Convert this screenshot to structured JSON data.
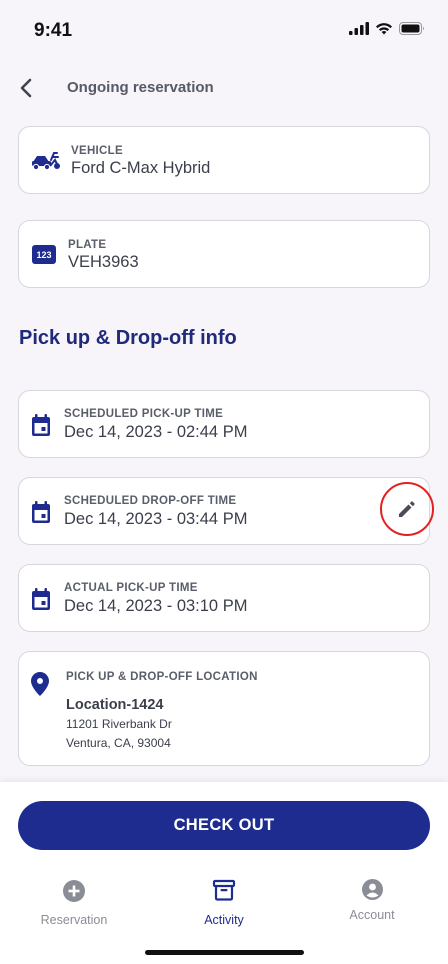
{
  "status_bar": {
    "time": "9:41"
  },
  "header": {
    "title": "Ongoing reservation"
  },
  "vehicle": {
    "label": "VEHICLE",
    "value": "Ford C-Max Hybrid"
  },
  "plate": {
    "label": "PLATE",
    "value": "VEH3963",
    "icon_text": "123"
  },
  "section": {
    "title": "Pick up & Drop-off info"
  },
  "scheduled_pickup": {
    "label": "SCHEDULED PICK-UP TIME",
    "value": "Dec 14, 2023 - 02:44 PM"
  },
  "scheduled_dropoff": {
    "label": "SCHEDULED DROP-OFF TIME",
    "value": "Dec 14, 2023 - 03:44 PM"
  },
  "actual_pickup": {
    "label": "ACTUAL PICK-UP TIME",
    "value": "Dec 14, 2023 - 03:10 PM"
  },
  "location": {
    "label": "PICK UP & DROP-OFF LOCATION",
    "name": "Location-1424",
    "address_line1": "11201 Riverbank Dr",
    "address_line2": "Ventura, CA, 93004"
  },
  "checkout": {
    "label": "CHECK OUT"
  },
  "nav": {
    "reservation": "Reservation",
    "activity": "Activity",
    "account": "Account"
  },
  "colors": {
    "primary": "#1f2c8f",
    "section_title": "#1f2a7a",
    "highlight_ring": "#e02222",
    "inactive_nav": "#8a8d96"
  }
}
